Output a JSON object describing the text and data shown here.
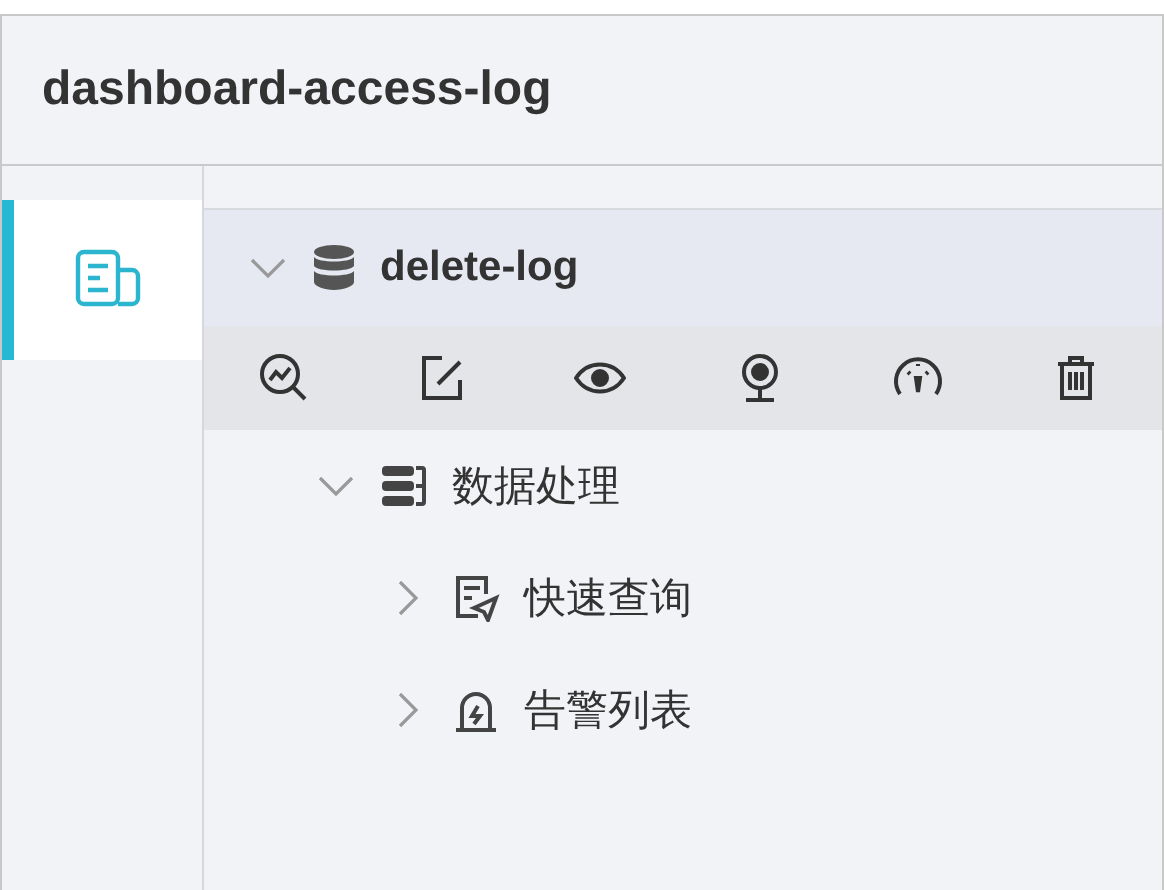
{
  "window": {
    "title": "dashboard-access-log"
  },
  "sidebar": {
    "items": [
      {
        "kind": "documents",
        "selected": true
      }
    ]
  },
  "tree": [
    {
      "label": "delete-log",
      "kind": "database",
      "expanded": true,
      "children": [
        {
          "label": "数据处理",
          "kind": "layers",
          "expanded": true,
          "children": [
            {
              "label": "快速查询",
              "kind": "query",
              "expanded": false
            },
            {
              "label": "告警列表",
              "kind": "alarm",
              "expanded": false
            }
          ]
        }
      ]
    }
  ],
  "toolbar": [
    {
      "kind": "analyze"
    },
    {
      "kind": "edit"
    },
    {
      "kind": "view"
    },
    {
      "kind": "camera"
    },
    {
      "kind": "gauge"
    },
    {
      "kind": "delete"
    }
  ]
}
